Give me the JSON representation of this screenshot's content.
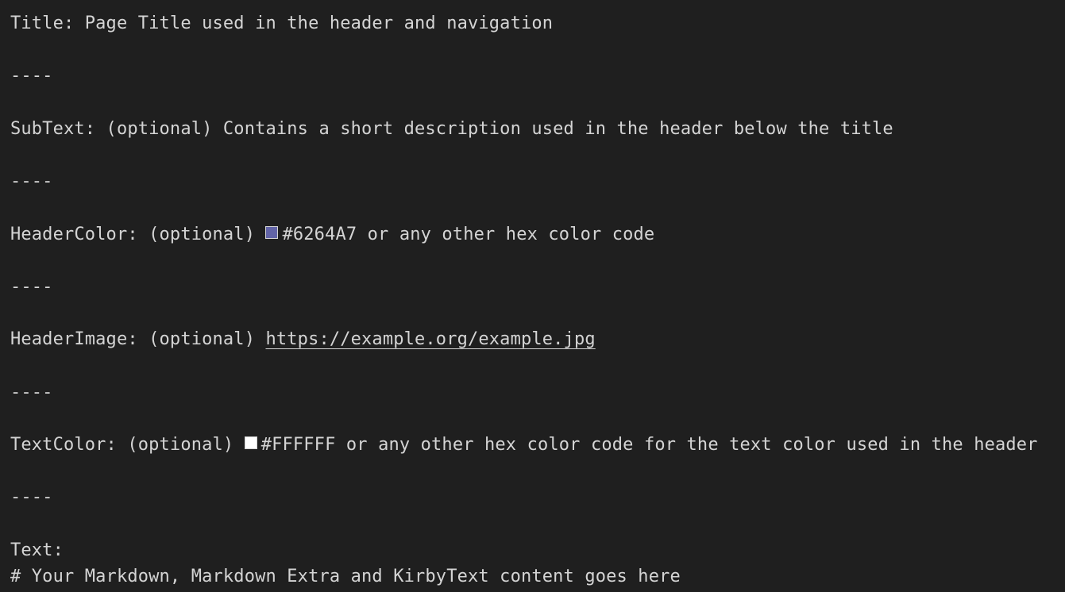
{
  "lines": {
    "title": "Title: Page Title used in the header and navigation",
    "sep1": "----",
    "subtext": "SubText: (optional) Contains a short description used in the header below the title",
    "sep2": "----",
    "header_color_prefix": "HeaderColor: (optional) ",
    "header_color_value": "#6264A7",
    "header_color_suffix": " or any other hex color code",
    "sep3": "----",
    "header_image_prefix": "HeaderImage: (optional) ",
    "header_image_url": "https://example.org/example.jpg",
    "sep4": "----",
    "text_color_prefix": "TextColor: (optional) ",
    "text_color_value": "#FFFFFF",
    "text_color_suffix": " or any other hex color code for the text color used in the header",
    "sep5": "----",
    "text_label": "Text:",
    "text_content": "# Your Markdown, Markdown Extra and KirbyText content goes here"
  },
  "colors": {
    "background": "#1f1f1f",
    "foreground": "#d4d4d4",
    "header_swatch": "#6264A7",
    "text_swatch": "#FFFFFF"
  }
}
